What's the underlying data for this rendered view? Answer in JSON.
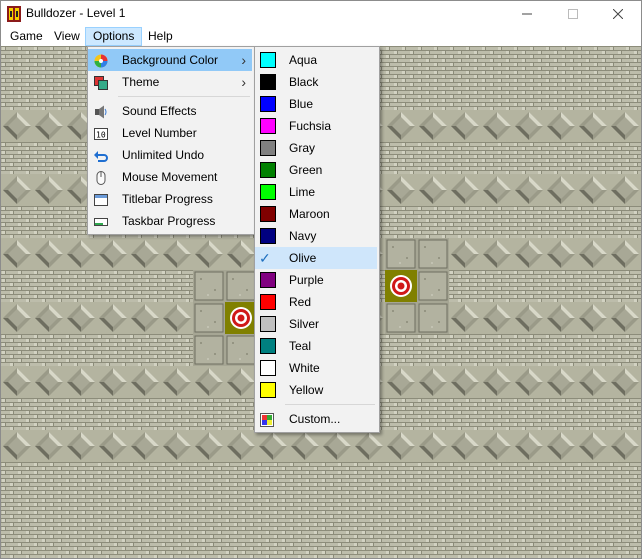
{
  "window": {
    "title": "Bulldozer - Level 1",
    "minimize_icon": "minimize-icon",
    "maximize_icon": "maximize-icon",
    "close_icon": "close-icon"
  },
  "menubar": {
    "items": [
      "Game",
      "View",
      "Options",
      "Help"
    ],
    "active": "Options"
  },
  "options_menu": {
    "items": [
      {
        "label": "Background Color",
        "icon": "palette-icon",
        "submenu": true
      },
      {
        "label": "Theme",
        "icon": "theme-icon",
        "submenu": true
      },
      {
        "label": "Sound Effects",
        "icon": "speaker-icon"
      },
      {
        "label": "Level Number",
        "icon": "number-icon"
      },
      {
        "label": "Unlimited Undo",
        "icon": "undo-icon"
      },
      {
        "label": "Mouse Movement",
        "icon": "mouse-icon"
      },
      {
        "label": "Titlebar Progress",
        "icon": "titlebar-icon"
      },
      {
        "label": "Taskbar Progress",
        "icon": "taskbar-icon"
      }
    ]
  },
  "color_menu": {
    "items": [
      {
        "label": "Aqua",
        "color": "#00ffff"
      },
      {
        "label": "Black",
        "color": "#000000"
      },
      {
        "label": "Blue",
        "color": "#0000ff"
      },
      {
        "label": "Fuchsia",
        "color": "#ff00ff"
      },
      {
        "label": "Gray",
        "color": "#808080"
      },
      {
        "label": "Green",
        "color": "#008000"
      },
      {
        "label": "Lime",
        "color": "#00ff00"
      },
      {
        "label": "Maroon",
        "color": "#800000"
      },
      {
        "label": "Navy",
        "color": "#000080"
      },
      {
        "label": "Olive",
        "color": "#808000",
        "checked": true
      },
      {
        "label": "Purple",
        "color": "#800080"
      },
      {
        "label": "Red",
        "color": "#ff0000"
      },
      {
        "label": "Silver",
        "color": "#c0c0c0"
      },
      {
        "label": "Teal",
        "color": "#008080"
      },
      {
        "label": "White",
        "color": "#ffffff"
      },
      {
        "label": "Yellow",
        "color": "#ffff00"
      }
    ],
    "custom_label": "Custom...",
    "custom_icon": "custom-color-icon",
    "check_icon": "checkmark-icon"
  },
  "colors": {
    "menu_highlight": "#91c9f7",
    "menubar_active": "#cce8ff",
    "board_background": "#808000"
  }
}
